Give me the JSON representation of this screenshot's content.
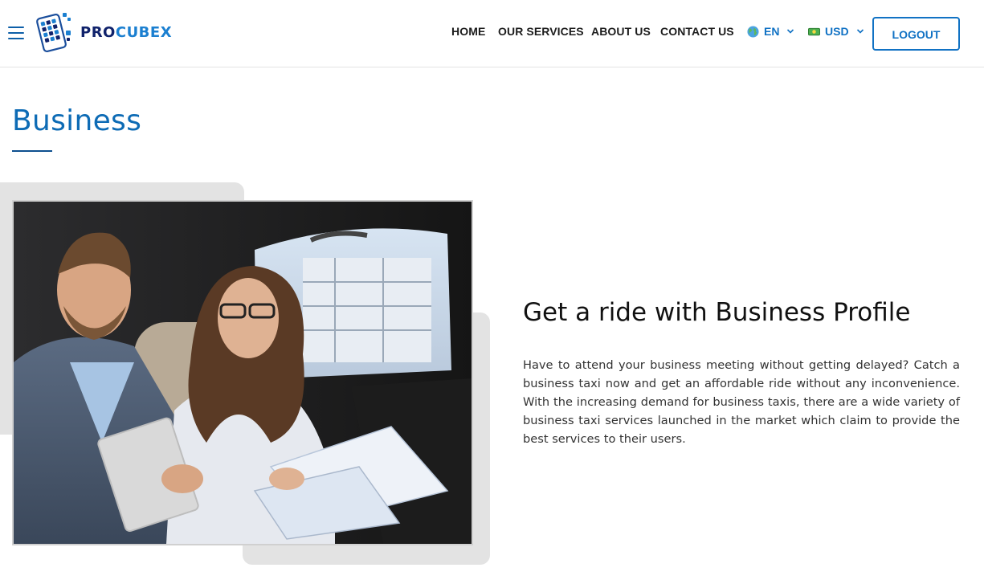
{
  "header": {
    "logo": {
      "prefix": "PRO",
      "suffix": "CUBEX"
    },
    "nav": [
      {
        "label": "HOME"
      },
      {
        "label": "OUR SERVICES"
      },
      {
        "label": "ABOUT US"
      },
      {
        "label": "CONTACT US"
      }
    ],
    "language": {
      "label": "EN",
      "icon": "globe-icon"
    },
    "currency": {
      "label": "USD",
      "icon": "banknote-icon"
    },
    "logout_label": "LOGOUT"
  },
  "page": {
    "title": "Business"
  },
  "feature": {
    "title": "Get a ride with Business Profile",
    "body": "Have to attend your business meeting without getting delayed? Catch a business taxi now and get an affordable ride without any inconvenience. With the increasing demand for business taxis, there are a wide variety of business taxi services launched in the market which claim to provide the best services to their users."
  },
  "colors": {
    "brand_blue": "#1172c4",
    "title_blue": "#0d6bb5",
    "logo_dark": "#10226b",
    "panel_gray": "#e3e3e3"
  }
}
